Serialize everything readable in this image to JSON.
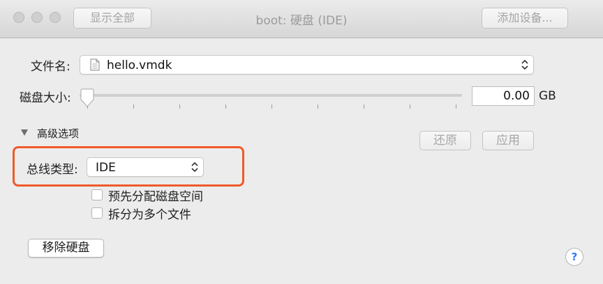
{
  "window": {
    "title": "boot: 硬盘 (IDE)",
    "show_all_button": "显示全部",
    "add_device_button": "添加设备..."
  },
  "file": {
    "label": "文件名:",
    "value": "hello.vmdk",
    "icon": "document-icon"
  },
  "disk_size": {
    "label": "磁盘大小:",
    "value": "0.00",
    "unit": "GB",
    "slider_level": 0
  },
  "advanced": {
    "label": "高级选项",
    "expanded": true,
    "revert_button": "还原",
    "apply_button": "应用"
  },
  "bus": {
    "label": "总线类型:",
    "value": "IDE",
    "highlight_color": "#f05a28"
  },
  "options": [
    {
      "label": "预先分配磁盘空间",
      "checked": false
    },
    {
      "label": "拆分为多个文件",
      "checked": false
    }
  ],
  "remove_button": "移除硬盘",
  "help_symbol": "?"
}
